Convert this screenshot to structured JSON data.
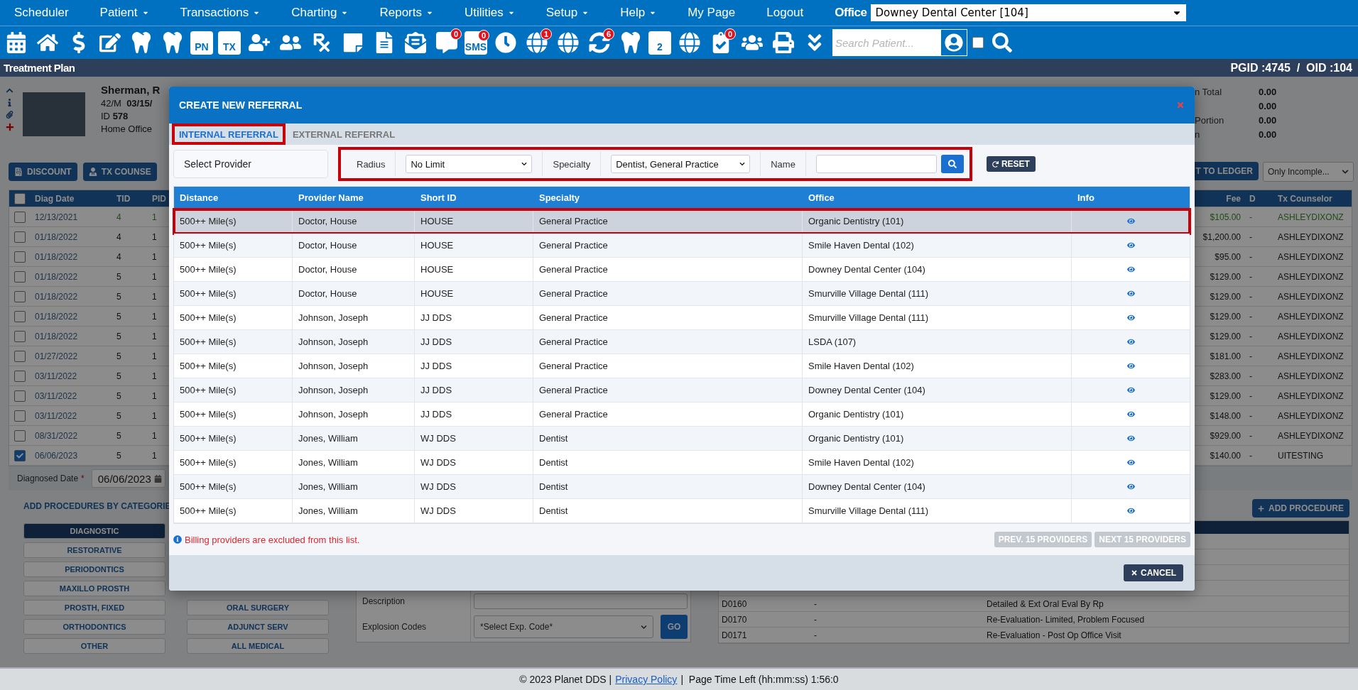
{
  "nav": {
    "items": [
      {
        "label": "Scheduler",
        "dropdown": false
      },
      {
        "label": "Patient",
        "dropdown": true
      },
      {
        "label": "Transactions",
        "dropdown": true
      },
      {
        "label": "Charting",
        "dropdown": true
      },
      {
        "label": "Reports",
        "dropdown": true
      },
      {
        "label": "Utilities",
        "dropdown": true
      },
      {
        "label": "Setup",
        "dropdown": true
      },
      {
        "label": "Help",
        "dropdown": true
      },
      {
        "label": "My Page",
        "dropdown": false
      },
      {
        "label": "Logout",
        "dropdown": false
      }
    ],
    "office_label": "Office",
    "office_value": "Downey Dental Center [104]"
  },
  "toolbar": {
    "items": [
      {
        "kind": "calendar"
      },
      {
        "kind": "home"
      },
      {
        "kind": "dollar"
      },
      {
        "kind": "edit"
      },
      {
        "kind": "tooth-doc"
      },
      {
        "kind": "tooth"
      },
      {
        "kind": "label-doc",
        "label": "PN"
      },
      {
        "kind": "label-doc",
        "label": "TX"
      },
      {
        "kind": "user-plus"
      },
      {
        "kind": "users-plus"
      },
      {
        "kind": "rx"
      },
      {
        "kind": "note"
      },
      {
        "kind": "scan"
      },
      {
        "kind": "mail"
      },
      {
        "kind": "chat",
        "badge": "0"
      },
      {
        "kind": "sms",
        "label": "SMS",
        "badge": "0"
      },
      {
        "kind": "clock"
      },
      {
        "kind": "globe-user",
        "badge": "1"
      },
      {
        "kind": "globe-user"
      },
      {
        "kind": "refresh-user",
        "badge": "6"
      },
      {
        "kind": "tooth-doc"
      },
      {
        "kind": "label-tooth",
        "label": "2"
      },
      {
        "kind": "globe-cursor"
      },
      {
        "kind": "doc-check",
        "badge": "0"
      },
      {
        "kind": "group"
      },
      {
        "kind": "printer"
      },
      {
        "kind": "collapse"
      }
    ],
    "search_placeholder": "Search Patient...",
    "checkbox_checked": false
  },
  "title_bar": {
    "title": "Treatment Plan",
    "ids": "PGID :4745  /  OID :104"
  },
  "patient": {
    "name": "Sherman, R",
    "age_sex": "42/M",
    "dob": "03/15/",
    "id_label": "ID",
    "id": "578",
    "office": "Home Office"
  },
  "summary": [
    {
      "label": "n Total",
      "value": "0.00"
    },
    {
      "value": "0.00"
    },
    {
      "label": "Portion",
      "value": "0.00"
    },
    {
      "label": "n",
      "value": "0.00"
    }
  ],
  "actions": {
    "discount": "DISCOUNT",
    "counselor": "TX COUNSE",
    "ledger": "T TO LEDGER",
    "filter": "Only Incomple..."
  },
  "treatments": {
    "select_all_checked": false,
    "columns_left": [
      "Diag Date",
      "TID",
      "PID"
    ],
    "columns_right": [
      "Fee",
      "D",
      "Tx Counselor"
    ],
    "rows": [
      {
        "checked": false,
        "highlighted": true,
        "diag_date": "12/13/2021",
        "tid": "4",
        "pid": "1",
        "fee": "$105.00",
        "d": "-",
        "counselor": "ASHLEYDIXONZ"
      },
      {
        "checked": false,
        "highlighted": false,
        "diag_date": "01/18/2022",
        "tid": "4",
        "pid": "1",
        "fee": "$1,200.00",
        "d": "-",
        "counselor": "ASHLEYDIXONZ"
      },
      {
        "checked": false,
        "highlighted": false,
        "diag_date": "01/18/2022",
        "tid": "4",
        "pid": "1",
        "fee": "$95.00",
        "d": "-",
        "counselor": "ASHLEYDIXONZ"
      },
      {
        "checked": false,
        "highlighted": false,
        "diag_date": "01/18/2022",
        "tid": "5",
        "pid": "1",
        "fee": "$129.00",
        "d": "-",
        "counselor": "ASHLEYDIXONZ"
      },
      {
        "checked": false,
        "highlighted": false,
        "diag_date": "01/18/2022",
        "tid": "5",
        "pid": "1",
        "fee": "$129.00",
        "d": "-",
        "counselor": "ASHLEYDIXONZ"
      },
      {
        "checked": false,
        "highlighted": false,
        "diag_date": "01/18/2022",
        "tid": "5",
        "pid": "1",
        "fee": "$129.00",
        "d": "-",
        "counselor": "ASHLEYDIXONZ"
      },
      {
        "checked": false,
        "highlighted": false,
        "diag_date": "01/18/2022",
        "tid": "5",
        "pid": "1",
        "fee": "$129.00",
        "d": "-",
        "counselor": "ASHLEYDIXONZ"
      },
      {
        "checked": false,
        "highlighted": false,
        "diag_date": "01/27/2022",
        "tid": "5",
        "pid": "1",
        "fee": "$181.00",
        "d": "-",
        "counselor": "ASHLEYDIXONZ"
      },
      {
        "checked": false,
        "highlighted": false,
        "diag_date": "03/11/2022",
        "tid": "5",
        "pid": "1",
        "fee": "$283.00",
        "d": "-",
        "counselor": "ASHLEYDIXONZ"
      },
      {
        "checked": false,
        "highlighted": false,
        "diag_date": "03/11/2022",
        "tid": "5",
        "pid": "1",
        "fee": "$129.00",
        "d": "-",
        "counselor": "ASHLEYDIXONZ"
      },
      {
        "checked": false,
        "highlighted": false,
        "diag_date": "03/11/2022",
        "tid": "5",
        "pid": "1",
        "fee": "$148.00",
        "d": "-",
        "counselor": "ASHLEYDIXONZ"
      },
      {
        "checked": false,
        "highlighted": false,
        "diag_date": "08/31/2022",
        "tid": "5",
        "pid": "1",
        "fee": "$929.00",
        "d": "-",
        "counselor": "ASHLEYDIXONZ"
      },
      {
        "checked": true,
        "highlighted": false,
        "diag_date": "06/06/2023",
        "tid": "5",
        "pid": "1",
        "fee": "$140.00",
        "d": "-",
        "counselor": "UITESTING"
      }
    ]
  },
  "diagnosed_date": {
    "label": "Diagnosed Date",
    "required_mark": "*",
    "value": "06/06/2023"
  },
  "procedures": {
    "title": "ADD PROCEDURES BY CATEGORIE",
    "add_button": "ADD PROCEDURE",
    "categories_left": [
      {
        "label": "DIAGNOSTIC",
        "selected": true
      },
      {
        "label": "RESTORATIVE",
        "selected": false
      },
      {
        "label": "PERIODONTICS",
        "selected": false
      },
      {
        "label": "MAXILLO PROSTH",
        "selected": false
      },
      {
        "label": "PROSTH, FIXED",
        "selected": false
      },
      {
        "label": "ORTHODONTICS",
        "selected": false
      },
      {
        "label": "OTHER",
        "selected": false
      }
    ],
    "categories_right": [
      {
        "label": "ORAL SURGERY",
        "selected": false
      },
      {
        "label": "ADJUNCT SERV",
        "selected": false
      },
      {
        "label": "ALL MEDICAL",
        "selected": false
      }
    ],
    "description_label": "Description",
    "explosion_label": "Explosion Codes",
    "explosion_placeholder": "*Select Exp. Code*",
    "go": "GO",
    "codes": [
      {
        "code": "D0160",
        "dash": "-",
        "description": "Detailed & Ext Oral Eval By Rp"
      },
      {
        "code": "D0170",
        "dash": "-",
        "description": "Re-Evaluation- Limited, Problem Focused"
      },
      {
        "code": "D0171",
        "dash": "-",
        "description": "Re-Evaluation - Post Op Office Visit"
      }
    ]
  },
  "footer": {
    "copyright": "© 2023 Planet DDS |",
    "link": "Privacy Policy",
    "time": "|  Page Time Left (hh:mm:ss) 1:56:0"
  },
  "modal": {
    "title": "CREATE NEW REFERRAL",
    "tabs": [
      {
        "label": "INTERNAL REFERRAL",
        "selected": true,
        "outlined": true
      },
      {
        "label": "EXTERNAL REFERRAL",
        "selected": false,
        "outlined": false
      }
    ],
    "filters": {
      "select_label": "Select Provider",
      "outlined": true,
      "radius_label": "Radius",
      "radius_value": "No Limit",
      "specialty_label": "Specialty",
      "specialty_value": "Dentist, General Practice",
      "name_label": "Name",
      "reset": "RESET"
    },
    "columns": [
      "Distance",
      "Provider Name",
      "Short ID",
      "Specialty",
      "Office",
      "Info"
    ],
    "rows": [
      {
        "distance": "500++ Mile(s)",
        "provider": "Doctor, House",
        "short_id": "HOUSE",
        "specialty": "General Practice",
        "office": "Organic Dentistry (101)",
        "selected": true,
        "outlined": true
      },
      {
        "distance": "500++ Mile(s)",
        "provider": "Doctor, House",
        "short_id": "HOUSE",
        "specialty": "General Practice",
        "office": "Smile Haven Dental (102)",
        "selected": false,
        "outlined": false
      },
      {
        "distance": "500++ Mile(s)",
        "provider": "Doctor, House",
        "short_id": "HOUSE",
        "specialty": "General Practice",
        "office": "Downey Dental Center (104)",
        "selected": false,
        "outlined": false
      },
      {
        "distance": "500++ Mile(s)",
        "provider": "Doctor, House",
        "short_id": "HOUSE",
        "specialty": "General Practice",
        "office": "Smurville Village Dental (111)",
        "selected": false,
        "outlined": false
      },
      {
        "distance": "500++ Mile(s)",
        "provider": "Johnson, Joseph",
        "short_id": "JJ DDS",
        "specialty": "General Practice",
        "office": "Smurville Village Dental (111)",
        "selected": false,
        "outlined": false
      },
      {
        "distance": "500++ Mile(s)",
        "provider": "Johnson, Joseph",
        "short_id": "JJ DDS",
        "specialty": "General Practice",
        "office": "LSDA (107)",
        "selected": false,
        "outlined": false
      },
      {
        "distance": "500++ Mile(s)",
        "provider": "Johnson, Joseph",
        "short_id": "JJ DDS",
        "specialty": "General Practice",
        "office": "Smile Haven Dental (102)",
        "selected": false,
        "outlined": false
      },
      {
        "distance": "500++ Mile(s)",
        "provider": "Johnson, Joseph",
        "short_id": "JJ DDS",
        "specialty": "General Practice",
        "office": "Downey Dental Center (104)",
        "selected": false,
        "outlined": false
      },
      {
        "distance": "500++ Mile(s)",
        "provider": "Johnson, Joseph",
        "short_id": "JJ DDS",
        "specialty": "General Practice",
        "office": "Organic Dentistry (101)",
        "selected": false,
        "outlined": false
      },
      {
        "distance": "500++ Mile(s)",
        "provider": "Jones, William",
        "short_id": "WJ DDS",
        "specialty": "Dentist",
        "office": "Organic Dentistry (101)",
        "selected": false,
        "outlined": false
      },
      {
        "distance": "500++ Mile(s)",
        "provider": "Jones, William",
        "short_id": "WJ DDS",
        "specialty": "Dentist",
        "office": "Smile Haven Dental (102)",
        "selected": false,
        "outlined": false
      },
      {
        "distance": "500++ Mile(s)",
        "provider": "Jones, William",
        "short_id": "WJ DDS",
        "specialty": "Dentist",
        "office": "Downey Dental Center (104)",
        "selected": false,
        "outlined": false
      },
      {
        "distance": "500++ Mile(s)",
        "provider": "Jones, William",
        "short_id": "WJ DDS",
        "specialty": "Dentist",
        "office": "Smurville Village Dental (111)",
        "selected": false,
        "outlined": false
      }
    ],
    "note": "Billing providers are excluded from this list.",
    "prev": {
      "label": "PREV. 15 PROVIDERS",
      "disabled": true
    },
    "next": {
      "label": "NEXT 15 PROVIDERS",
      "disabled": true
    },
    "cancel": "CANCEL"
  }
}
